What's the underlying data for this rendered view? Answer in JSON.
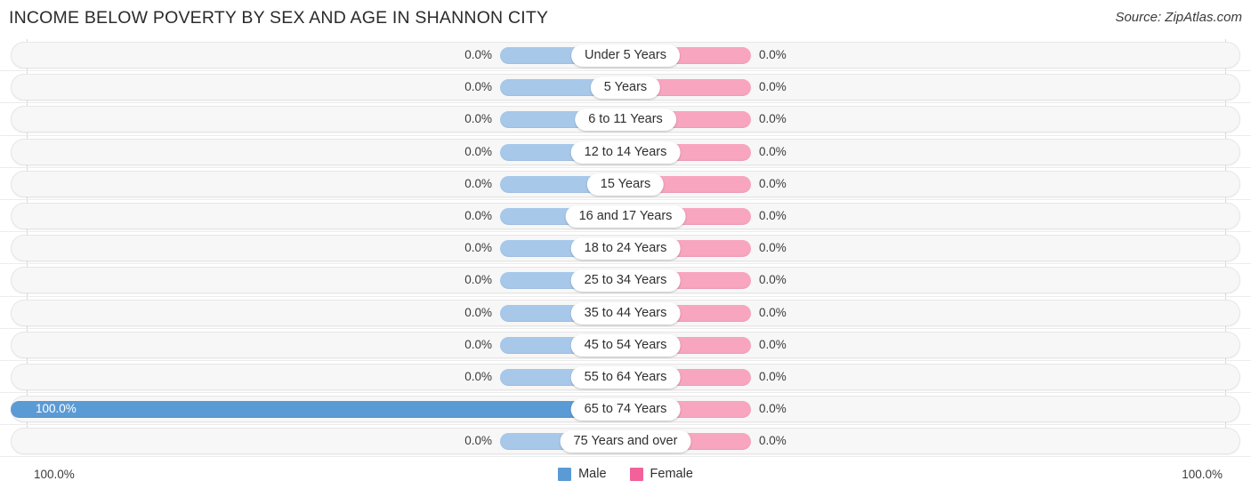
{
  "header": {
    "title": "INCOME BELOW POVERTY BY SEX AND AGE IN SHANNON CITY",
    "source": "Source: ZipAtlas.com"
  },
  "footer": {
    "axis_start": "100.0%",
    "axis_end": "100.0%",
    "legend": [
      {
        "label": "Male",
        "color": "#5b9bd5",
        "name": "legend-male"
      },
      {
        "label": "Female",
        "color": "#f2619a",
        "name": "legend-female"
      }
    ]
  },
  "colors": {
    "male_bar": "#a8c8ea",
    "female_bar": "#f8a5c0",
    "male_full": "#5b9bd5",
    "female_full": "#f2619a",
    "track": "#f7f7f7",
    "gridline": "#d9d9d9"
  },
  "chart_data": {
    "type": "bar",
    "title": "INCOME BELOW POVERTY BY SEX AND AGE IN SHANNON CITY",
    "subtitle": "Source: ZipAtlas.com",
    "orientation": "horizontal-diverging",
    "xlabel": "",
    "ylabel": "",
    "xlim": [
      -100,
      100
    ],
    "axis_tick_labels": [
      "100.0%",
      "100.0%"
    ],
    "grid": true,
    "legend_position": "bottom-center",
    "categories": [
      "Under 5 Years",
      "5 Years",
      "6 to 11 Years",
      "12 to 14 Years",
      "15 Years",
      "16 and 17 Years",
      "18 to 24 Years",
      "25 to 34 Years",
      "35 to 44 Years",
      "45 to 54 Years",
      "55 to 64 Years",
      "65 to 74 Years",
      "75 Years and over"
    ],
    "series": [
      {
        "name": "Male",
        "color": "#5b9bd5",
        "values": [
          0.0,
          0.0,
          0.0,
          0.0,
          0.0,
          0.0,
          0.0,
          0.0,
          0.0,
          0.0,
          0.0,
          100.0,
          0.0
        ],
        "labels": [
          "0.0%",
          "0.0%",
          "0.0%",
          "0.0%",
          "0.0%",
          "0.0%",
          "0.0%",
          "0.0%",
          "0.0%",
          "0.0%",
          "0.0%",
          "100.0%",
          "0.0%"
        ]
      },
      {
        "name": "Female",
        "color": "#f2619a",
        "values": [
          0.0,
          0.0,
          0.0,
          0.0,
          0.0,
          0.0,
          0.0,
          0.0,
          0.0,
          0.0,
          0.0,
          0.0,
          0.0
        ],
        "labels": [
          "0.0%",
          "0.0%",
          "0.0%",
          "0.0%",
          "0.0%",
          "0.0%",
          "0.0%",
          "0.0%",
          "0.0%",
          "0.0%",
          "0.0%",
          "0.0%",
          "0.0%"
        ]
      }
    ]
  }
}
